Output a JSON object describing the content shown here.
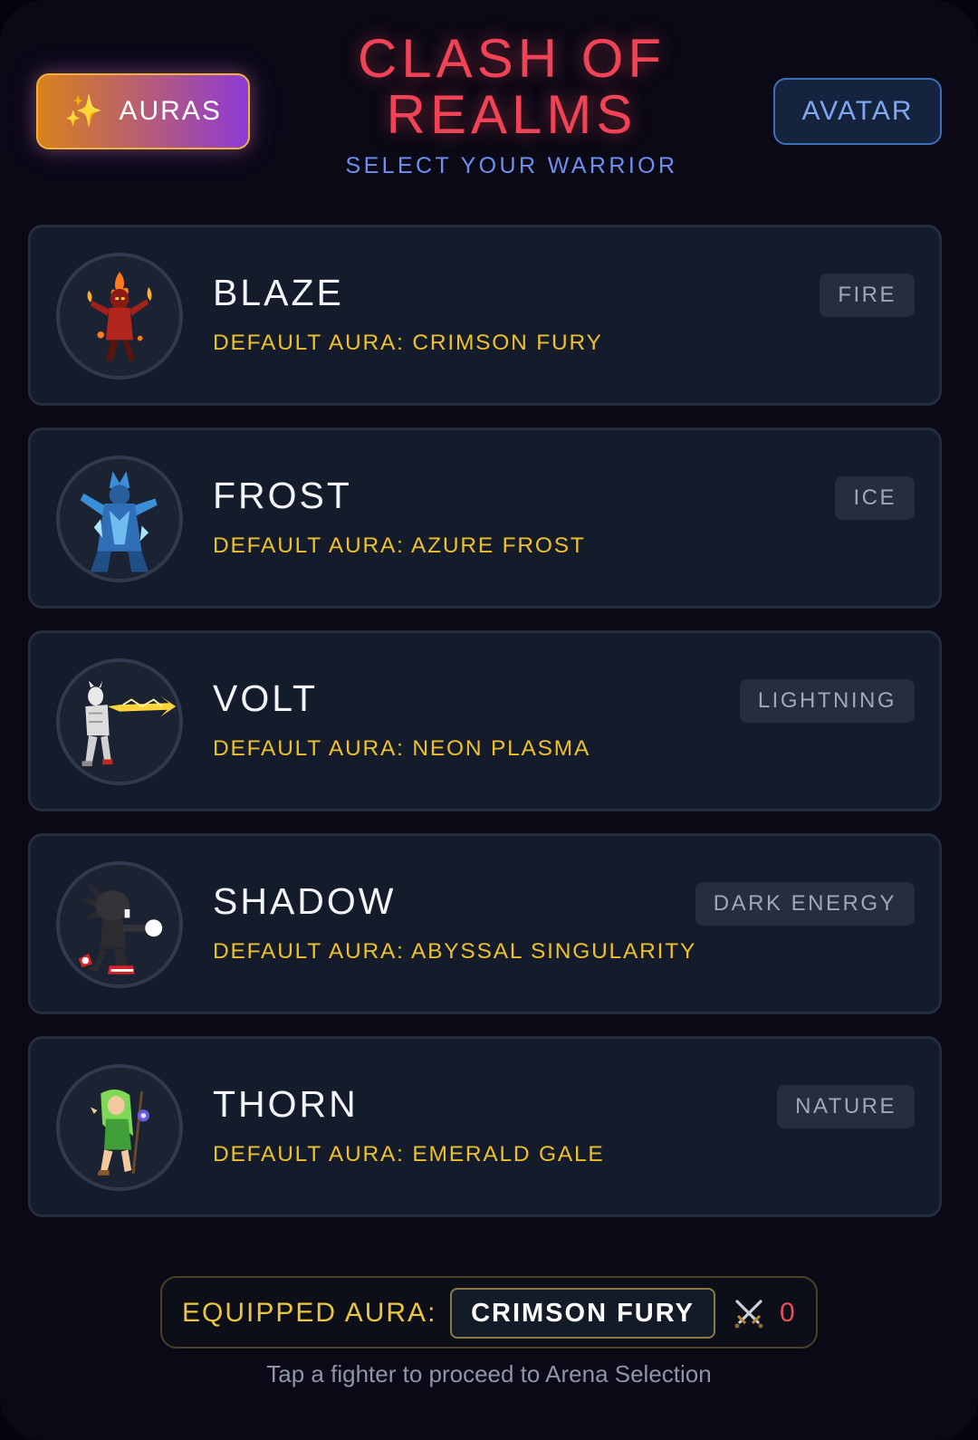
{
  "header": {
    "auras_button": {
      "icon": "sparkles-icon",
      "label": "AURAS"
    },
    "title_line1": "CLASH OF",
    "title_line2": "REALMS",
    "subtitle": "SELECT YOUR WARRIOR",
    "avatar_button": {
      "label": "AVATAR"
    }
  },
  "fighters": [
    {
      "name": "BLAZE",
      "element": "FIRE",
      "aura": "DEFAULT AURA: CRIMSON FURY",
      "portrait": "fire-mage-portrait"
    },
    {
      "name": "FROST",
      "element": "ICE",
      "aura": "DEFAULT AURA: AZURE FROST",
      "portrait": "ice-knight-portrait"
    },
    {
      "name": "VOLT",
      "element": "LIGHTNING",
      "aura": "DEFAULT AURA: NEON PLASMA",
      "portrait": "lightning-fighter-portrait"
    },
    {
      "name": "SHADOW",
      "element": "DARK ENERGY",
      "aura": "DEFAULT AURA: ABYSSAL SINGULARITY",
      "portrait": "dark-hedgehog-portrait"
    },
    {
      "name": "THORN",
      "element": "NATURE",
      "aura": "DEFAULT AURA: EMERALD GALE",
      "portrait": "forest-elf-portrait"
    }
  ],
  "footer": {
    "equipped_label": "EQUIPPED AURA:",
    "equipped_value": "CRIMSON FURY",
    "battle_icon": "crossed-swords-icon",
    "battle_count": "0",
    "hint": "Tap a fighter to proceed to Arena Selection"
  },
  "colors": {
    "background": "#0b0916",
    "title": "#f04355",
    "subtitle": "#6f8ff0",
    "aura_text": "#eec12c",
    "card": "#141b2a",
    "badge": "#242e3e"
  }
}
